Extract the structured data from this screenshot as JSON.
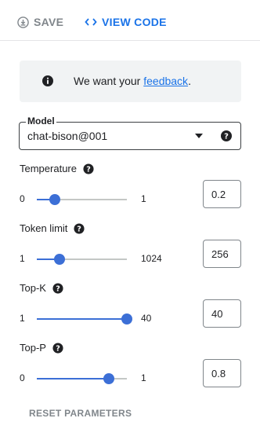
{
  "toolbar": {
    "save_label": "SAVE",
    "view_code_label": "VIEW CODE"
  },
  "banner": {
    "text_before": "We want your ",
    "link_text": "feedback",
    "text_after": "."
  },
  "model": {
    "label": "Model",
    "value": "chat-bison@001",
    "icons": [
      "dropdown-caret-icon",
      "help-icon"
    ]
  },
  "params": [
    {
      "name": "Temperature",
      "min": "0",
      "max": "1",
      "value": "0.2",
      "level": 0.2
    },
    {
      "name": "Token limit",
      "min": "1",
      "max": "1024",
      "value": "256",
      "level": 0.25
    },
    {
      "name": "Top-K",
      "min": "1",
      "max": "40",
      "value": "40",
      "level": 1.0
    },
    {
      "name": "Top-P",
      "min": "0",
      "max": "1",
      "value": "0.8",
      "level": 0.8
    }
  ],
  "reset_label": "RESET PARAMETERS",
  "colors": {
    "accent": "#1a73e8",
    "slider": "#3c6fd6",
    "muted": "#80868b",
    "banner_bg": "#f1f3f4"
  }
}
